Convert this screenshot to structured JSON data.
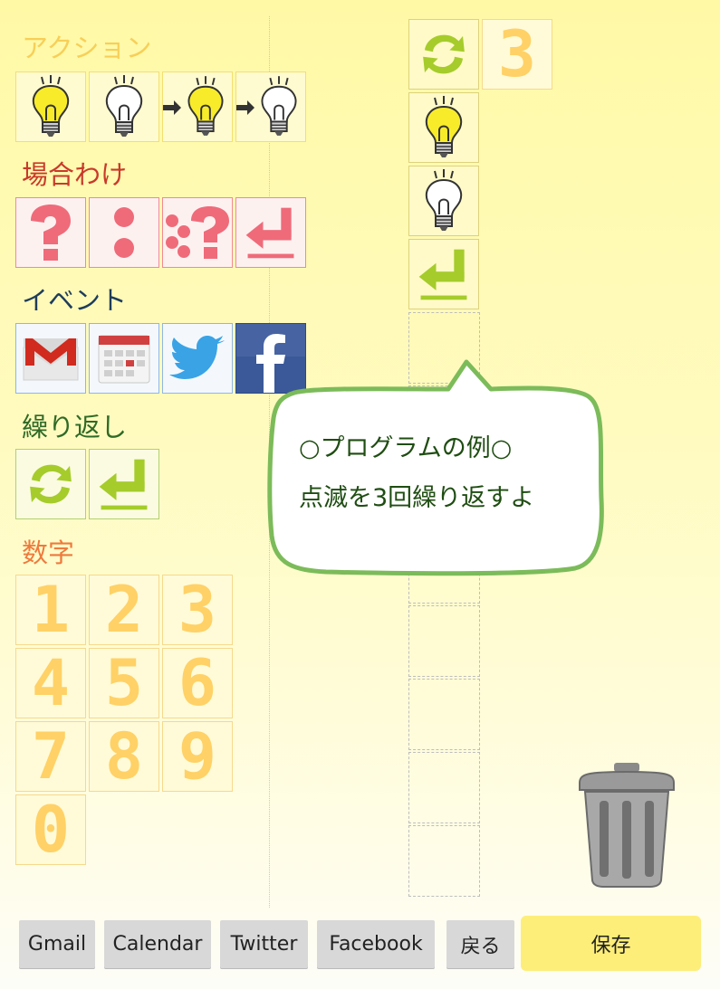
{
  "palette": {
    "action": {
      "heading": "アクション",
      "color": "#f7cf58",
      "icons": [
        "bulb-on-icon",
        "bulb-off-icon",
        "arrow-bulb-on-icon",
        "arrow-bulb-off-icon"
      ]
    },
    "condition": {
      "heading": "場合わけ",
      "color": "#c83a2a",
      "icons": [
        "question-icon",
        "colon-icon",
        "colon-question-icon",
        "return-arrow-icon"
      ]
    },
    "event": {
      "heading": "イベント",
      "color": "#1e3c5c",
      "icons": [
        "gmail-icon",
        "calendar-icon",
        "twitter-icon",
        "facebook-icon"
      ]
    },
    "loop": {
      "heading": "繰り返し",
      "color": "#2f6a26",
      "icons": [
        "loop-icon",
        "return-arrow-icon"
      ]
    },
    "number": {
      "heading": "数字",
      "color": "#ee7a3c",
      "digits": [
        "1",
        "2",
        "3",
        "4",
        "5",
        "6",
        "7",
        "8",
        "9",
        "0"
      ]
    }
  },
  "program": {
    "loop_count": "3",
    "blocks": [
      "loop-icon",
      "bulb-on-icon",
      "bulb-off-icon",
      "return-arrow-icon"
    ]
  },
  "tooltip": {
    "line1": "○プログラムの例○",
    "line2": "点滅を3回繰り返すよ"
  },
  "buttons": {
    "gmail": "Gmail",
    "calendar": "Calendar",
    "twitter": "Twitter",
    "facebook": "Facebook",
    "back": "戻る",
    "save": "保存"
  },
  "trash_icon": "trash-can-icon"
}
